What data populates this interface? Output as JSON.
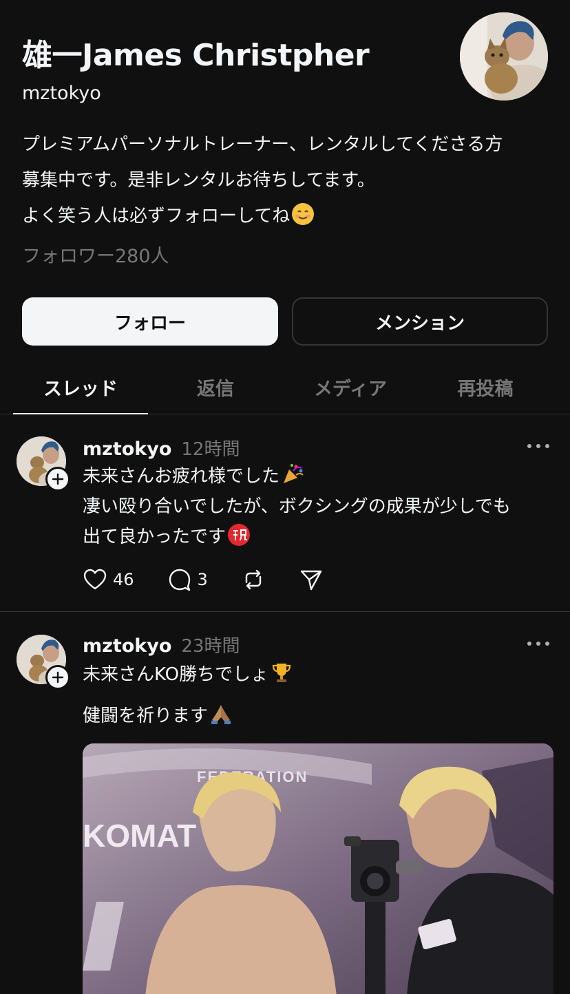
{
  "profile": {
    "name": "雄一James Christpher",
    "handle": "mztokyo",
    "bio_lines": [
      "プレミアムパーソナルトレーナー、レンタルしてくださる方",
      "募集中です。是非レンタルお待ちしてます。",
      "よく笑う人は必ずフォローしてね"
    ],
    "followers": "フォロワー280人"
  },
  "buttons": {
    "follow": "フォロー",
    "mention": "メンション"
  },
  "tabs": [
    "スレッド",
    "返信",
    "メディア",
    "再投稿"
  ],
  "posts": [
    {
      "user": "mztokyo",
      "time": "12時間",
      "lines": [
        "未来さんお疲れ様でした",
        "凄い殴り合いでしたが、ボクシングの成果が少しでも",
        "出て良かったです"
      ],
      "likes": "46",
      "replies": "3"
    },
    {
      "user": "mztokyo",
      "time": "23時間",
      "lines": [
        "未来さんKO勝ちでしょ",
        "健闘を祈ります"
      ],
      "image_text_top": "FEDERATION",
      "image_text_side": "KOMAT"
    }
  ],
  "colors": {
    "background": "#101010",
    "text_primary": "#f3f5f7",
    "text_secondary": "#777777",
    "border": "#333638"
  }
}
